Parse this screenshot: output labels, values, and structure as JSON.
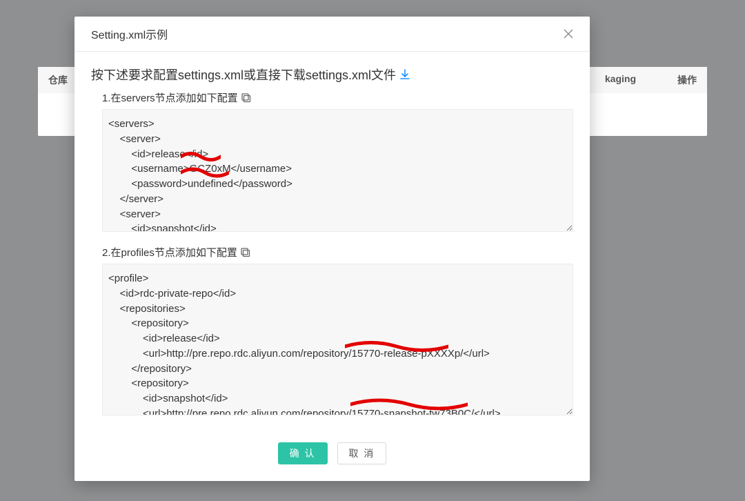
{
  "background_table": {
    "col_left": "仓库",
    "col_mid": "kaging",
    "col_right": "操作"
  },
  "modal": {
    "title": "Setting.xml示例",
    "instruction": "按下述要求配置settings.xml或直接下载settings.xml文件",
    "step1_label": "1.在servers节点添加如下配置",
    "step2_label": "2.在profiles节点添加如下配置",
    "code1": "<servers>\n    <server>\n        <id>release</id>\n        <username>GCZ0xM</username>\n        <password>undefined</password>\n    </server>\n    <server>\n        <id>snapshot</id>",
    "code2": "<profile>\n    <id>rdc-private-repo</id>\n    <repositories>\n        <repository>\n            <id>release</id>\n            <url>http://pre.repo.rdc.aliyun.com/repository/15770-release-pXXXXp/</url>\n        </repository>\n        <repository>\n            <id>snapshot</id>\n            <url>http://pre.repo.rdc.aliyun.com/repository/15770-snapshot-tw73B0C/</url>",
    "ok_label": "确 认",
    "cancel_label": "取 消"
  }
}
